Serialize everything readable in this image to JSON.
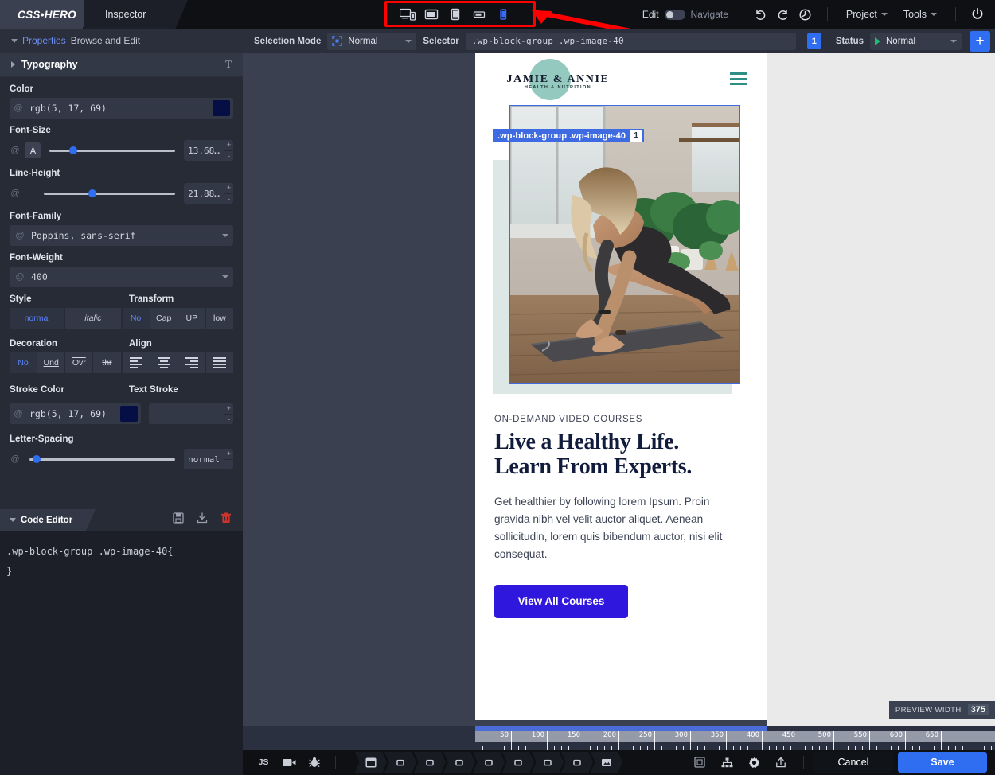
{
  "app": {
    "brand": "CSS•HERO",
    "tab": "Inspector"
  },
  "topbar": {
    "devices": [
      {
        "name": "desktop",
        "label": "Desktop",
        "active": false
      },
      {
        "name": "tablet-landscape",
        "label": "Tablet Landscape",
        "active": false
      },
      {
        "name": "tablet-portrait",
        "label": "Tablet Portrait",
        "active": false
      },
      {
        "name": "mobile-landscape",
        "label": "Mobile Landscape",
        "active": false
      },
      {
        "name": "mobile-portrait",
        "label": "Mobile Portrait",
        "active": true
      }
    ],
    "edit_label": "Edit",
    "navigate_label": "Navigate",
    "undo_icon": "undo-icon",
    "redo_icon": "redo-icon",
    "history_icon": "history-icon",
    "project_label": "Project",
    "tools_label": "Tools",
    "power_icon": "power-icon"
  },
  "selbar": {
    "selection_mode_label": "Selection Mode",
    "selection_mode_value": "Normal",
    "selector_label": "Selector",
    "selector_value": ".wp-block-group .wp-image-40",
    "count_badge": "1",
    "status_label": "Status",
    "status_value": "Normal",
    "add_label": "+"
  },
  "properties": {
    "toggle": "Properties",
    "subtitle": "Browse and Edit"
  },
  "typography": {
    "section_title": "Typography",
    "section_glyph": "T",
    "color": {
      "label": "Color",
      "value": "rgb(5, 17, 69)",
      "swatch": "#050e45"
    },
    "font_size": {
      "label": "Font-Size",
      "value": "13.68…",
      "slider_pct": 16
    },
    "line_height": {
      "label": "Line-Height",
      "value": "21.88…",
      "slider_pct": 34
    },
    "font_family": {
      "label": "Font-Family",
      "value": "Poppins, sans-serif"
    },
    "font_weight": {
      "label": "Font-Weight",
      "value": "400"
    },
    "style": {
      "label": "Style",
      "options": [
        "normal",
        "italic"
      ],
      "selected": "normal"
    },
    "transform": {
      "label": "Transform",
      "options": [
        "No",
        "Cap",
        "UP",
        "low"
      ],
      "selected": "No"
    },
    "decoration": {
      "label": "Decoration",
      "options": [
        "No",
        "Und",
        "Ovr",
        "thr"
      ],
      "selected": "No"
    },
    "align": {
      "label": "Align",
      "options": [
        "left",
        "center",
        "right",
        "justify"
      ],
      "selected": ""
    },
    "stroke_color": {
      "label": "Stroke Color",
      "value": "rgb(5, 17, 69)",
      "swatch": "#050e45"
    },
    "text_stroke": {
      "label": "Text Stroke",
      "value": ""
    },
    "letter_spacing": {
      "label": "Letter-Spacing",
      "value": "normal",
      "slider_pct": 2
    },
    "at_glyph": "@"
  },
  "code_editor": {
    "title": "Code Editor",
    "save_icon": "save-disk-icon",
    "import_icon": "import-icon",
    "delete_icon": "trash-icon",
    "code_line_1": ".wp-block-group .wp-image-40{",
    "code_line_2": "}"
  },
  "preview": {
    "overlay_label": ".wp-block-group .wp-image-40",
    "overlay_index": "1",
    "brand_name": "JAMIE & ANNIE",
    "brand_tagline": "HEALTH & NUTRITION",
    "menu_icon": "hamburger-menu-icon",
    "eyebrow": "ON-DEMAND VIDEO COURSES",
    "headline_line1": "Live a Healthy Life.",
    "headline_line2": "Learn From Experts.",
    "body": "Get healthier by following lorem Ipsum. Proin gravida nibh vel velit auctor aliquet. Aenean sollicitudin, lorem quis bibendum auctor, nisi elit consequat.",
    "cta_label": "View All Courses",
    "hero_image_alt": "woman in plank yoga pose on mat with plants",
    "accent_color": "#3017dd",
    "brand_circle_color": "#94c9c0"
  },
  "preview_width_tip": {
    "label": "PREVIEW WIDTH",
    "value": "375"
  },
  "ruler": {
    "marks": [
      50,
      100,
      150,
      200,
      250,
      300,
      350,
      400,
      450,
      500,
      550,
      600,
      650
    ],
    "highlight_end": 375
  },
  "bottombar": {
    "js_label": "JS",
    "video_icon": "video-camera-icon",
    "bug_icon": "bug-icon",
    "breadcrumb": [
      "browser-window-icon",
      "box-icon",
      "box-icon",
      "box-icon",
      "box-icon",
      "box-icon",
      "box-icon",
      "box-icon",
      "image-icon"
    ],
    "responsive_icon": "responsive-icon",
    "sitemap_icon": "sitemap-icon",
    "settings_icon": "gear-icon",
    "share_icon": "export-icon",
    "cancel_label": "Cancel",
    "save_label": "Save"
  }
}
